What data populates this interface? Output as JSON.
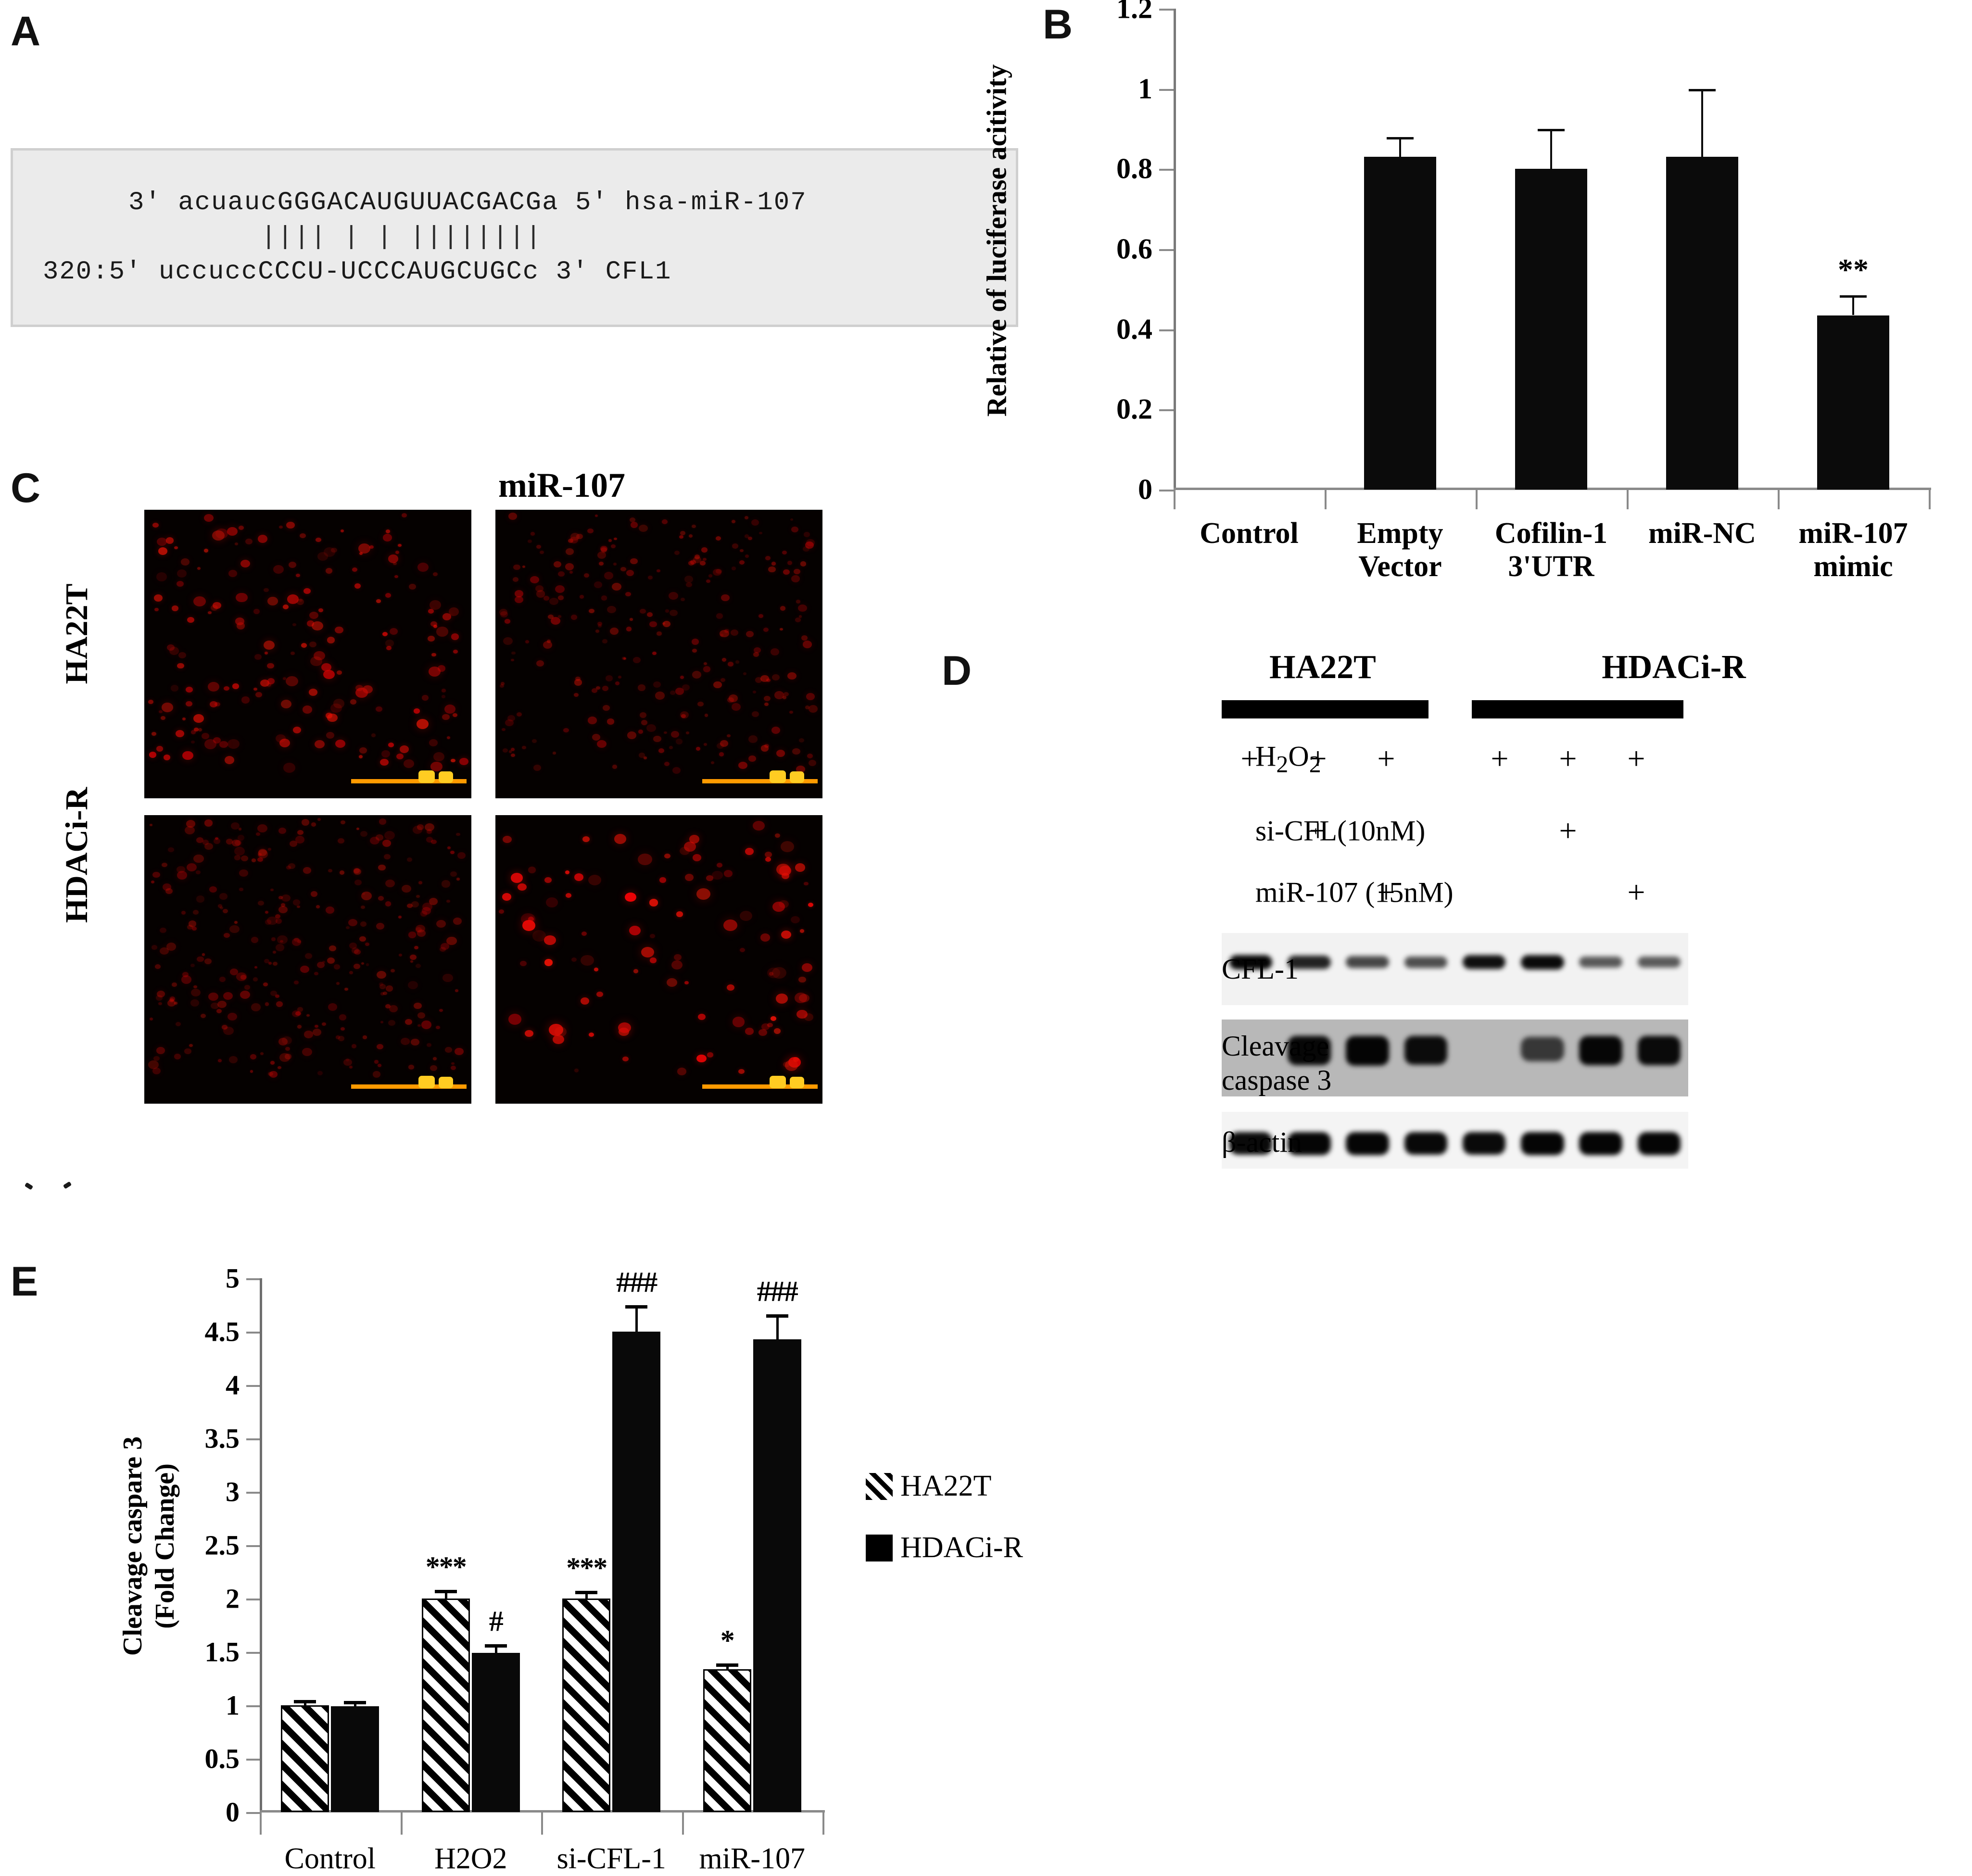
{
  "figure": {
    "panel_letters": {
      "a": "A",
      "b": "B",
      "c": "C",
      "d": "D",
      "e": "E"
    }
  },
  "panelA": {
    "seq_top": "3' acuaucGGGACAUGUUACGACGa 5' hsa-miR-107",
    "seq_pairing": "        |||| | | ||||||||",
    "seq_bottom": "320:5' uccuccCCCU-UCCCAUGCUGCc 3' CFL1"
  },
  "panelC": {
    "column_title": "miR-107",
    "row_labels": [
      "HA22T",
      "HDACi-R"
    ]
  },
  "panelD": {
    "group_headers": [
      "HA22T",
      "HDACi-R"
    ],
    "treatment_rows": [
      {
        "label": "H2O2",
        "label_html": "H<sub>2</sub>O<sub>2</sub>",
        "lanes": [
          "+",
          "+",
          "+",
          "",
          "+",
          "+",
          "+"
        ]
      },
      {
        "label": "si-CFL(10nM)",
        "lanes": [
          "",
          "+",
          "",
          "",
          "",
          "+",
          ""
        ]
      },
      {
        "label": "miR-107 (15nM)",
        "lanes": [
          "",
          "",
          "+",
          "",
          "",
          "",
          "+"
        ]
      }
    ],
    "blot_labels": [
      "CFL-1",
      "Cleavage caspase 3",
      "β-actin"
    ]
  },
  "chart_data": [
    {
      "panel": "B",
      "type": "bar",
      "title": "",
      "xlabel": "",
      "ylabel": "Relative of luciferase acitivity",
      "categories": [
        "Control",
        "Empty Vector",
        "Cofilin-1 3'UTR",
        "miR-NC",
        "miR-107 mimic"
      ],
      "category_lines": [
        [
          "Control"
        ],
        [
          "Empty",
          "Vector"
        ],
        [
          "Cofilin-1",
          "3'UTR"
        ],
        [
          "miR-NC"
        ],
        [
          "miR-107",
          "mimic"
        ]
      ],
      "values": [
        0,
        0.83,
        0.8,
        0.83,
        0.435
      ],
      "errors": [
        0,
        0.05,
        0.1,
        0.17,
        0.05
      ],
      "annotations": [
        null,
        null,
        null,
        null,
        "**"
      ],
      "ylim": [
        0,
        1.2
      ],
      "yticks": [
        0,
        0.2,
        0.4,
        0.6,
        0.8,
        1,
        1.2
      ],
      "ytick_labels": [
        "0",
        "0.2",
        "0.4",
        "0.6",
        "0.8",
        "1",
        "1.2"
      ],
      "grid": false,
      "legend": "none",
      "bar_color": "#0b0b0b"
    },
    {
      "panel": "E",
      "type": "bar",
      "title": "",
      "xlabel": "",
      "ylabel": "Cleavage caspare 3 (Fold Change)",
      "ylabel_lines": [
        "Cleavage caspare 3",
        "(Fold Change)"
      ],
      "categories": [
        "Control",
        "H2O2",
        "si-CFL-1",
        "miR-107"
      ],
      "series": [
        {
          "name": "HA22T",
          "style": "hatch",
          "values": [
            1.0,
            2.0,
            2.0,
            1.34
          ],
          "errors": [
            0.05,
            0.08,
            0.07,
            0.05
          ],
          "annotations": [
            null,
            "***",
            "***",
            "*"
          ]
        },
        {
          "name": "HDACi-R",
          "style": "solid",
          "values": [
            0.99,
            1.49,
            4.5,
            4.43
          ],
          "errors": [
            0.05,
            0.08,
            0.25,
            0.23
          ],
          "annotations": [
            null,
            "#",
            "###",
            "###"
          ]
        }
      ],
      "ylim": [
        0,
        5
      ],
      "yticks": [
        0,
        0.5,
        1,
        1.5,
        2,
        2.5,
        3,
        3.5,
        4,
        4.5,
        5
      ],
      "ytick_labels": [
        "0",
        "0.5",
        "1",
        "1.5",
        "2",
        "2.5",
        "3",
        "3.5",
        "4",
        "4.5",
        "5"
      ],
      "grid": false,
      "legend": "right",
      "legend_entries": [
        "HA22T",
        "HDACi-R"
      ]
    }
  ]
}
